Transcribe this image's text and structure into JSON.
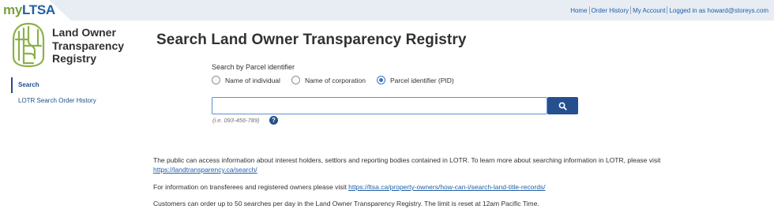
{
  "header": {
    "logo_my": "my",
    "logo_ltsa": "LTSA",
    "links": [
      "Home",
      "Order History",
      "My Account"
    ],
    "logged_in": "Logged in as howard@storeys.com"
  },
  "brand": {
    "line1": "Land Owner",
    "line2": "Transparency",
    "line3": "Registry"
  },
  "nav": {
    "items": [
      {
        "label": "Search",
        "active": true
      },
      {
        "label": "LOTR Search Order History",
        "active": false
      }
    ]
  },
  "main": {
    "title": "Search Land Owner Transparency Registry",
    "search_by_label": "Search by Parcel identifier",
    "options": [
      {
        "label": "Name of individual",
        "checked": false
      },
      {
        "label": "Name of corporation",
        "checked": false
      },
      {
        "label": "Parcel identifier (PID)",
        "checked": true
      }
    ],
    "search_value": "",
    "hint": "(i.e. 093-456-789)",
    "help_glyph": "?"
  },
  "info": {
    "p1_text": "The public can access information about interest holders, settlors and reporting bodies contained in LOTR. To learn more about searching information in LOTR, please visit",
    "p1_link": "https://landtransparency.ca/search/",
    "p2_text": "For information on transferees and registered owners please visit",
    "p2_link": "https://ltsa.ca/property-owners/how-can-i/search-land-title-records/",
    "p3_text": "Customers can order up to 50 searches per day in the Land Owner Transparency Registry. The limit is reset at 12am Pacific Time."
  },
  "colors": {
    "accent": "#24508f",
    "link": "#1f5fa8",
    "logo_green": "#7aa23b",
    "topbar": "#e8edf3"
  }
}
